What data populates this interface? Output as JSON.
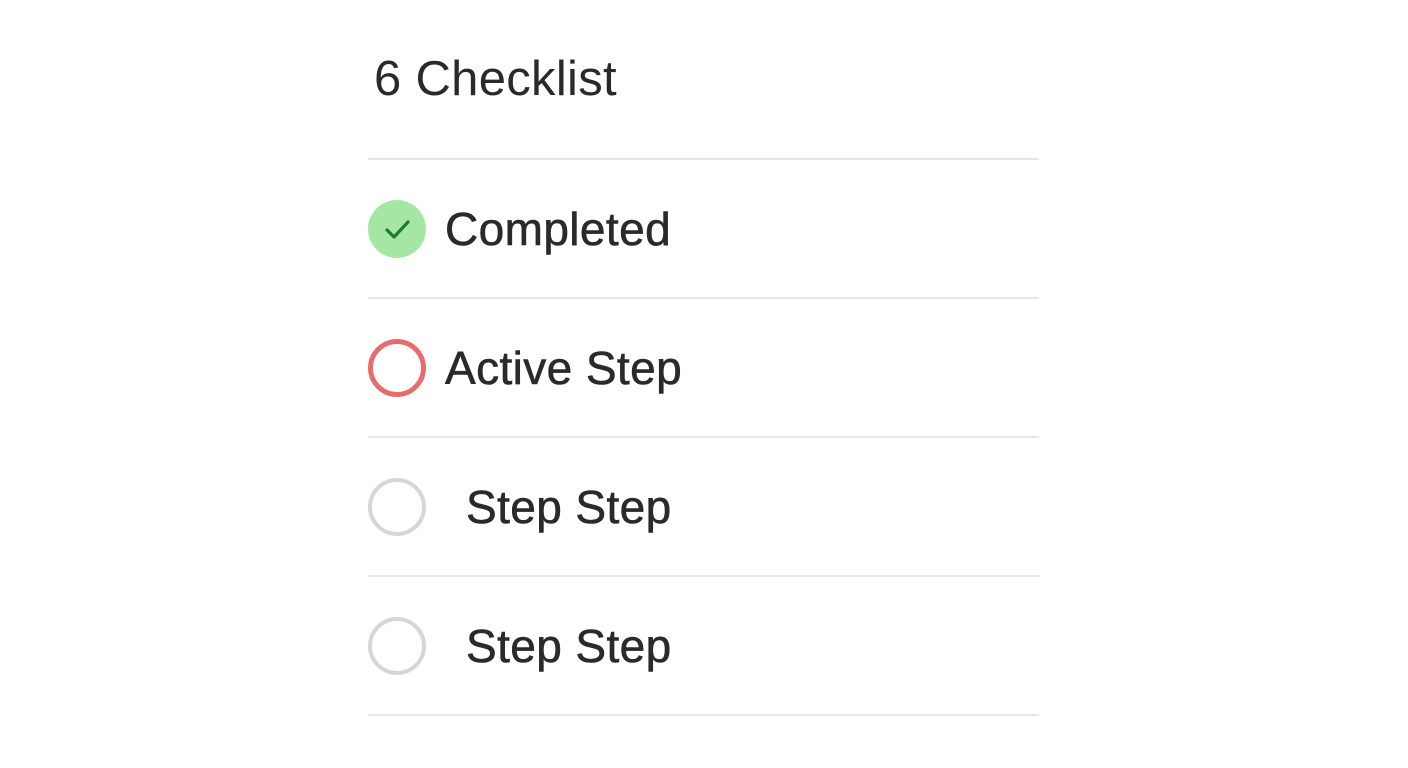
{
  "checklist": {
    "title": "6 Checklist",
    "items": [
      {
        "label": "Completed",
        "state": "completed",
        "icon": "check-icon",
        "color": "#a6e6a3"
      },
      {
        "label": "Active Step",
        "state": "active",
        "icon": "active-ring-icon",
        "color": "#e56d6d"
      },
      {
        "label": "Step Step",
        "state": "pending",
        "icon": "empty-circle-icon",
        "color": "#d6d6d6"
      },
      {
        "label": "Step Step",
        "state": "pending",
        "icon": "empty-circle-icon",
        "color": "#d6d6d6"
      }
    ]
  }
}
